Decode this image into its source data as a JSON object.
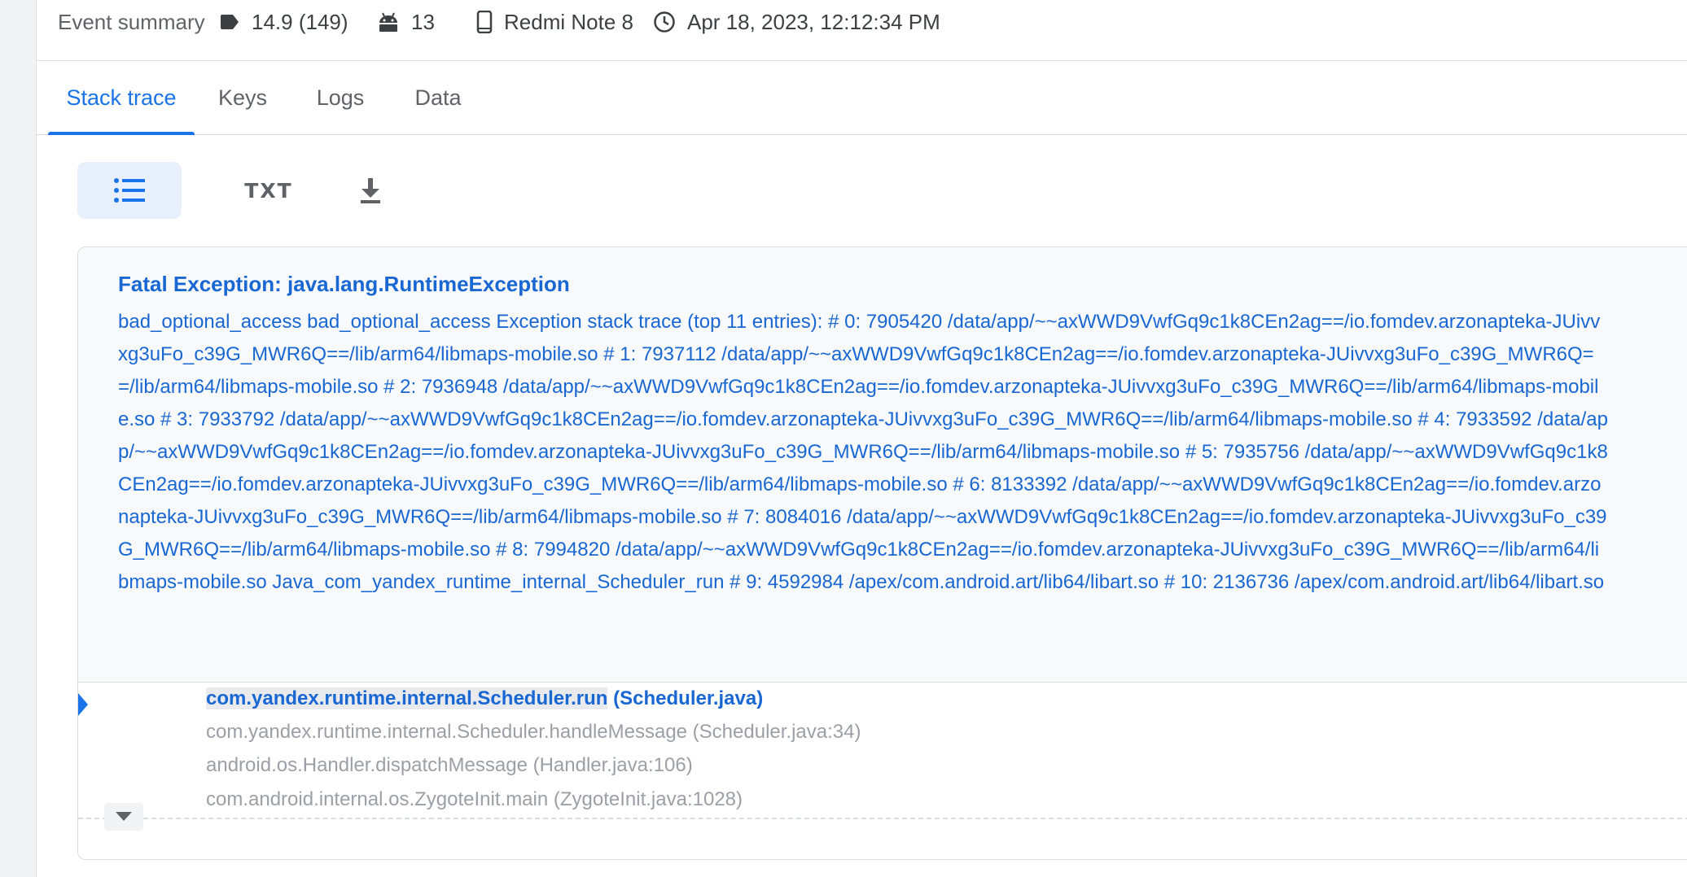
{
  "summary": {
    "title": "Event summary",
    "version": "14.9 (149)",
    "android_version": "13",
    "device": "Redmi Note 8",
    "timestamp": "Apr 18, 2023, 12:12:34 PM"
  },
  "tabs": [
    {
      "label": "Stack trace",
      "active": true
    },
    {
      "label": "Keys",
      "active": false
    },
    {
      "label": "Logs",
      "active": false
    },
    {
      "label": "Data",
      "active": false
    }
  ],
  "toolbar": {
    "list_view_icon": "list-icon",
    "txt_label": "TXT",
    "download_icon": "download-icon"
  },
  "exception": {
    "title": "Fatal Exception: java.lang.RuntimeException",
    "message": "bad_optional_access bad_optional_access Exception stack trace (top 11 entries): # 0: 7905420 /data/app/~~axWWD9VwfGq9c1k8CEn2ag==/io.fomdev.arzonapteka-JUivvxg3uFo_c39G_MWR6Q==/lib/arm64/libmaps-mobile.so # 1: 7937112 /data/app/~~axWWD9VwfGq9c1k8CEn2ag==/io.fomdev.arzonapteka-JUivvxg3uFo_c39G_MWR6Q==/lib/arm64/libmaps-mobile.so # 2: 7936948 /data/app/~~axWWD9VwfGq9c1k8CEn2ag==/io.fomdev.arzonapteka-JUivvxg3uFo_c39G_MWR6Q==/lib/arm64/libmaps-mobile.so # 3: 7933792 /data/app/~~axWWD9VwfGq9c1k8CEn2ag==/io.fomdev.arzonapteka-JUivvxg3uFo_c39G_MWR6Q==/lib/arm64/libmaps-mobile.so # 4: 7933592 /data/app/~~axWWD9VwfGq9c1k8CEn2ag==/io.fomdev.arzonapteka-JUivvxg3uFo_c39G_MWR6Q==/lib/arm64/libmaps-mobile.so # 5: 7935756 /data/app/~~axWWD9VwfGq9c1k8CEn2ag==/io.fomdev.arzonapteka-JUivvxg3uFo_c39G_MWR6Q==/lib/arm64/libmaps-mobile.so # 6: 8133392 /data/app/~~axWWD9VwfGq9c1k8CEn2ag==/io.fomdev.arzonapteka-JUivvxg3uFo_c39G_MWR6Q==/lib/arm64/libmaps-mobile.so # 7: 8084016 /data/app/~~axWWD9VwfGq9c1k8CEn2ag==/io.fomdev.arzonapteka-JUivvxg3uFo_c39G_MWR6Q==/lib/arm64/libmaps-mobile.so # 8: 7994820 /data/app/~~axWWD9VwfGq9c1k8CEn2ag==/io.fomdev.arzonapteka-JUivvxg3uFo_c39G_MWR6Q==/lib/arm64/libmaps-mobile.so Java_com_yandex_runtime_internal_Scheduler_run # 9: 4592984 /apex/com.android.art/lib64/libart.so # 10: 2136736 /apex/com.android.art/lib64/libart.so"
  },
  "frames": [
    {
      "method": "com.yandex.runtime.internal.Scheduler.run",
      "location": " (Scheduler.java)"
    },
    {
      "text": "com.yandex.runtime.internal.Scheduler.handleMessage (Scheduler.java:34)"
    },
    {
      "text": "android.os.Handler.dispatchMessage (Handler.java:106)"
    },
    {
      "text": "com.android.internal.os.ZygoteInit.main (ZygoteInit.java:1028)"
    }
  ],
  "colors": {
    "accent": "#1a73e8",
    "exception_text": "#1967d2",
    "muted_text": "#9aa0a6"
  }
}
